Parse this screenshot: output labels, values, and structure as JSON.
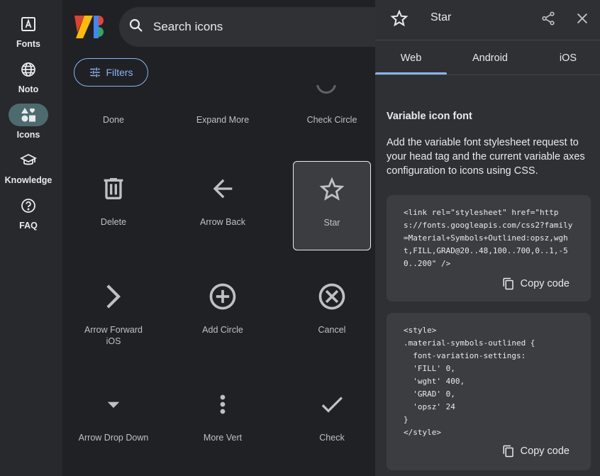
{
  "rail": {
    "items": [
      {
        "label": "Fonts"
      },
      {
        "label": "Noto"
      },
      {
        "label": "Icons"
      },
      {
        "label": "Knowledge"
      },
      {
        "label": "FAQ"
      }
    ]
  },
  "search": {
    "placeholder": "Search icons"
  },
  "filters": {
    "label": "Filters"
  },
  "icons": [
    {
      "label": "Done"
    },
    {
      "label": "Expand More"
    },
    {
      "label": "Check Circle"
    },
    {
      "label": "Delete"
    },
    {
      "label": "Arrow Back"
    },
    {
      "label": "Star"
    },
    {
      "label": "Arrow Forward iOS"
    },
    {
      "label": "Add Circle"
    },
    {
      "label": "Cancel"
    },
    {
      "label": "Arrow Drop Down"
    },
    {
      "label": "More Vert"
    },
    {
      "label": "Check"
    }
  ],
  "panel": {
    "title": "Star",
    "tabs": [
      {
        "label": "Web"
      },
      {
        "label": "Android"
      },
      {
        "label": "iOS"
      }
    ],
    "section_title": "Variable icon font",
    "section_desc": "Add the variable font stylesheet request to your head tag and the current variable axes configuration to icons using CSS.",
    "code1": "<link rel=\"stylesheet\" href=\"https://fonts.googleapis.com/css2?family=Material+Symbols+Outlined:opsz,wght,FILL,GRAD@20..48,100..700,0..1,-50..200\" />",
    "code2": "<style>\n.material-symbols-outlined {\n  font-variation-settings:\n  'FILL' 0,\n  'wght' 400,\n  'GRAD' 0,\n  'opsz' 24\n}\n</style>",
    "copy_label": "Copy code"
  },
  "colors": {
    "accent": "#8ab4f8",
    "active_rail": "#4d6b6f"
  }
}
